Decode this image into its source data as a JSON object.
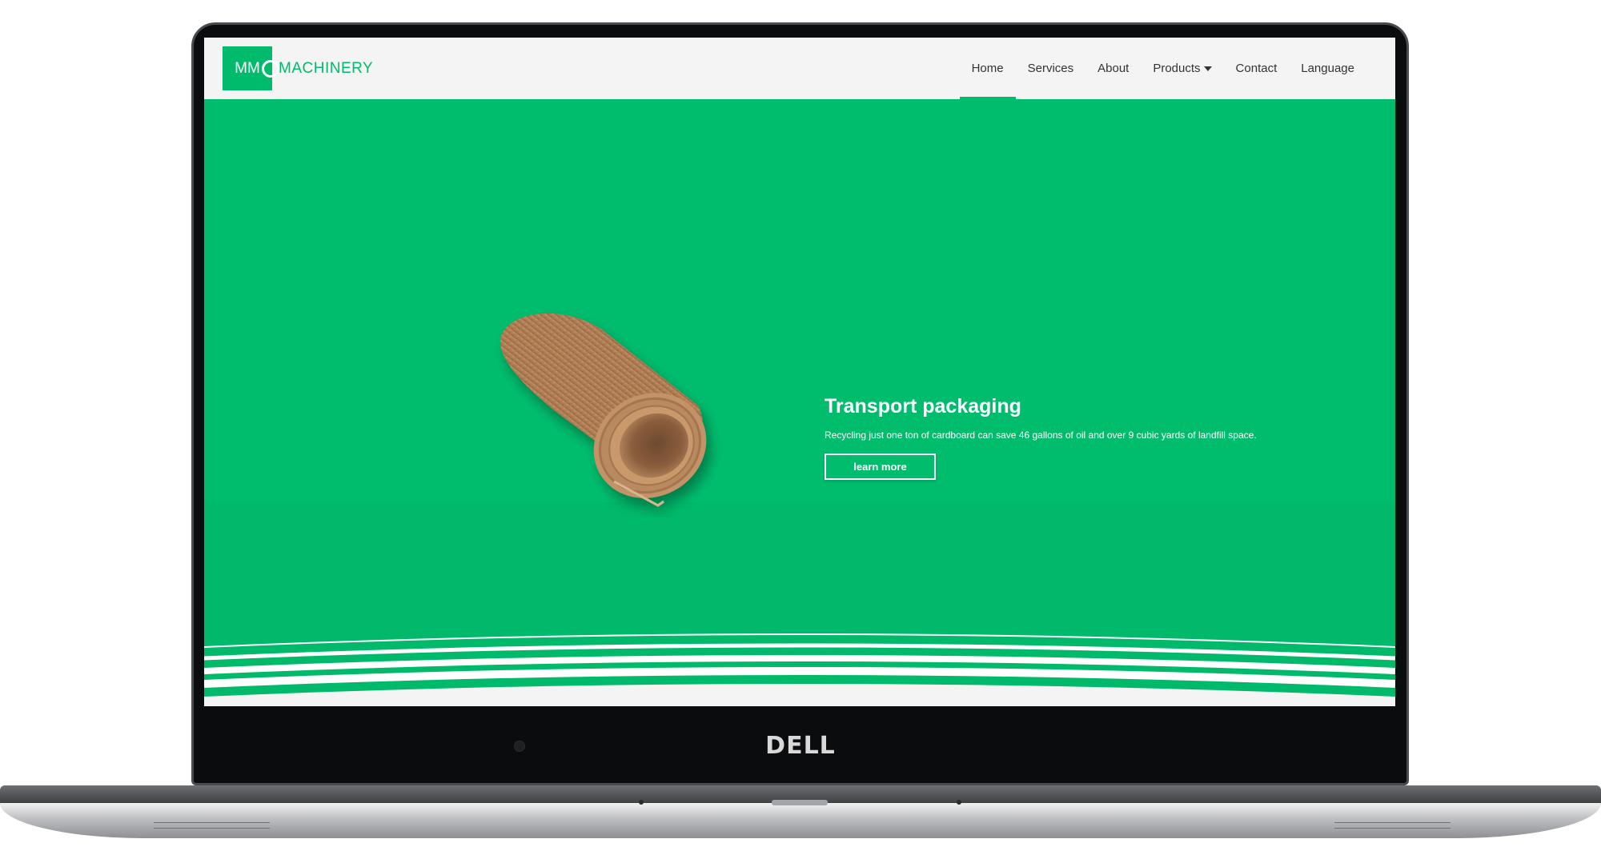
{
  "device": {
    "brand": "DELL"
  },
  "site": {
    "logo_badge": "MM",
    "logo_text": "MACHINERY",
    "accent_color": "#00bb6c"
  },
  "nav": {
    "items": [
      {
        "label": "Home",
        "active": true
      },
      {
        "label": "Services",
        "active": false
      },
      {
        "label": "About",
        "active": false
      },
      {
        "label": "Products",
        "active": false,
        "has_dropdown": true
      },
      {
        "label": "Contact",
        "active": false
      },
      {
        "label": "Language",
        "active": false
      }
    ],
    "dropdown_icon": "caret-down-icon"
  },
  "hero": {
    "title": "Transport packaging",
    "text": "Recycling just one ton of cardboard can save 46 gallons of oil and over 9 cubic yards of landfill space.",
    "button_label": "learn more",
    "image": "corrugated-cardboard-roll",
    "background_color": "#00bd6e"
  }
}
